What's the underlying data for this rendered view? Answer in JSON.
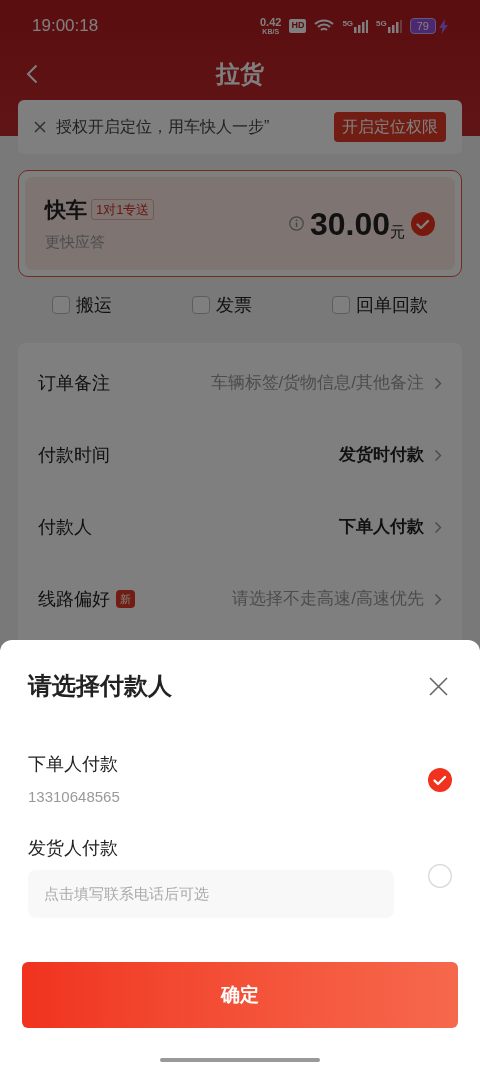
{
  "status_bar": {
    "time": "19:00:18",
    "net_speed": "0.42",
    "net_unit": "KB/S",
    "hd": "HD",
    "signals": [
      "5G",
      "5G"
    ],
    "battery": "79"
  },
  "header": {
    "title": "拉货"
  },
  "banner": {
    "text": "授权开启定位，用车快人一步”",
    "button": "开启定位权限"
  },
  "vehicle": {
    "name": "快车",
    "tag": "1对1专送",
    "subtitle": "更快应答",
    "price": "30.00",
    "unit": "元",
    "selected": true
  },
  "extras": [
    {
      "label": "搬运",
      "checked": false
    },
    {
      "label": "发票",
      "checked": false
    },
    {
      "label": "回单回款",
      "checked": false
    }
  ],
  "options": [
    {
      "label": "订单备注",
      "value": "车辆标签/货物信息/其他备注",
      "kind": "placeholder"
    },
    {
      "label": "付款时间",
      "value": "发货时付款",
      "kind": "value"
    },
    {
      "label": "付款人",
      "value": "下单人付款",
      "kind": "value"
    },
    {
      "label": "线路偏好",
      "badge": "新",
      "value": "请选择不走高速/高速优先",
      "kind": "placeholder"
    }
  ],
  "sheet": {
    "title": "请选择付款人",
    "payers": [
      {
        "label": "下单人付款",
        "phone": "13310648565",
        "selected": true
      },
      {
        "label": "发货人付款",
        "placeholder": "点击填写联系电话后可选",
        "selected": false
      }
    ],
    "confirm": "确定"
  }
}
